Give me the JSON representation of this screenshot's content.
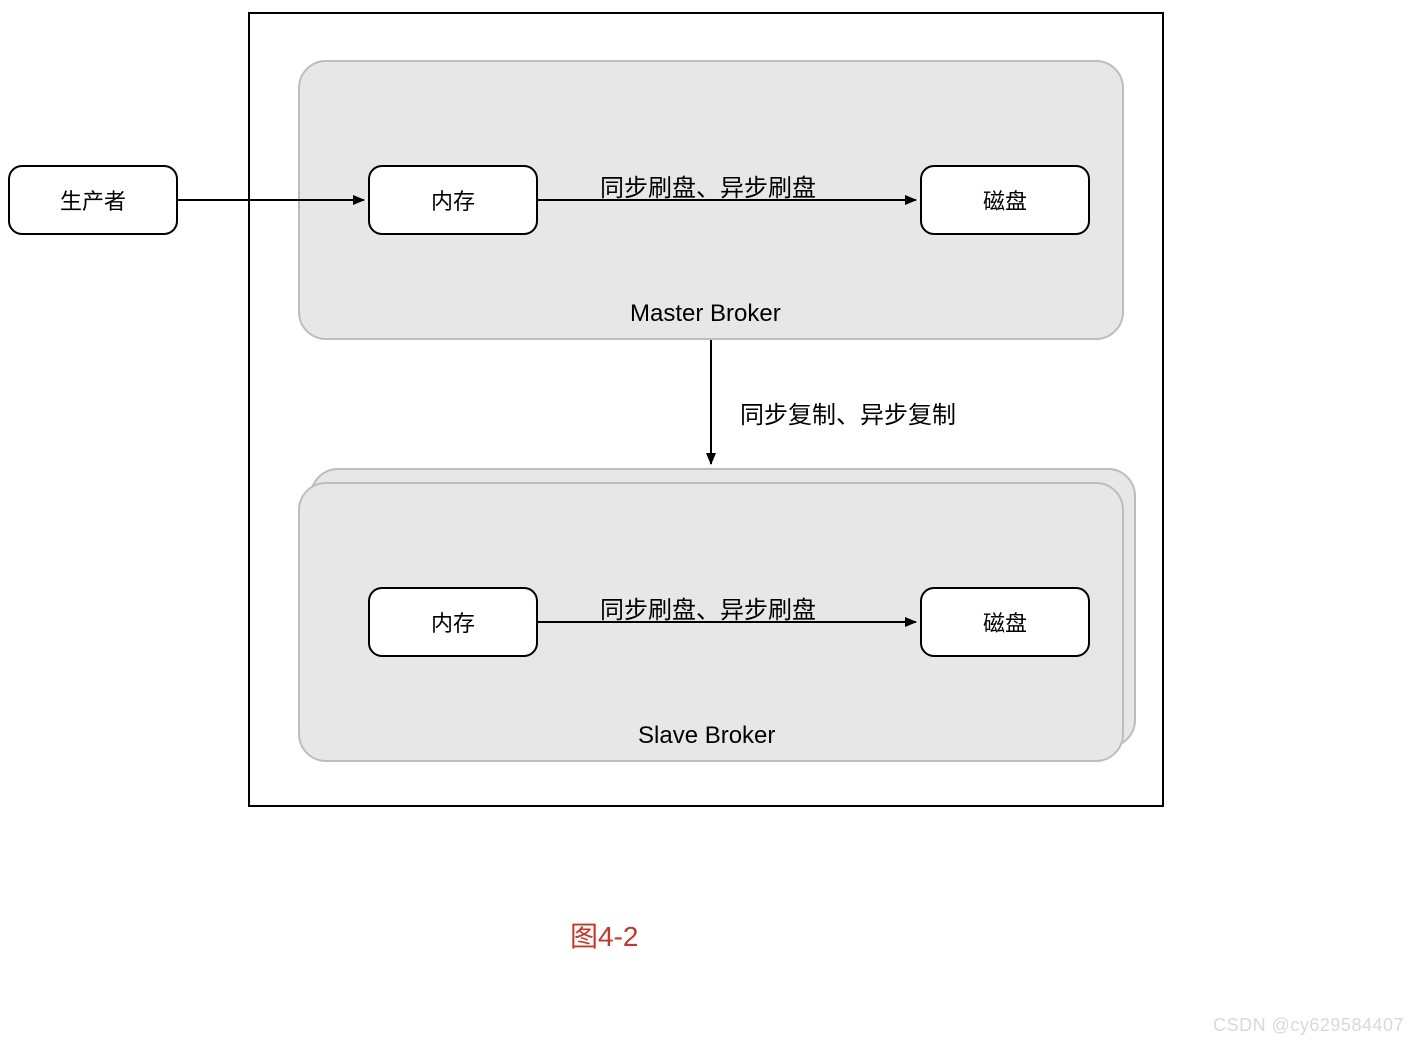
{
  "nodes": {
    "producer": "生产者",
    "memory": "内存",
    "disk": "磁盘"
  },
  "brokers": {
    "master": "Master Broker",
    "slave": "Slave Broker"
  },
  "arrows": {
    "flush_label": "同步刷盘、异步刷盘",
    "replicate_label": "同步复制、异步复制"
  },
  "caption": "图4-2",
  "watermark": "CSDN @cy629584407",
  "colors": {
    "panel_fill": "#e7e7e7",
    "panel_border": "#bdbdbd",
    "caption_color": "#c0392b",
    "watermark_color": "#d9d9d9"
  }
}
